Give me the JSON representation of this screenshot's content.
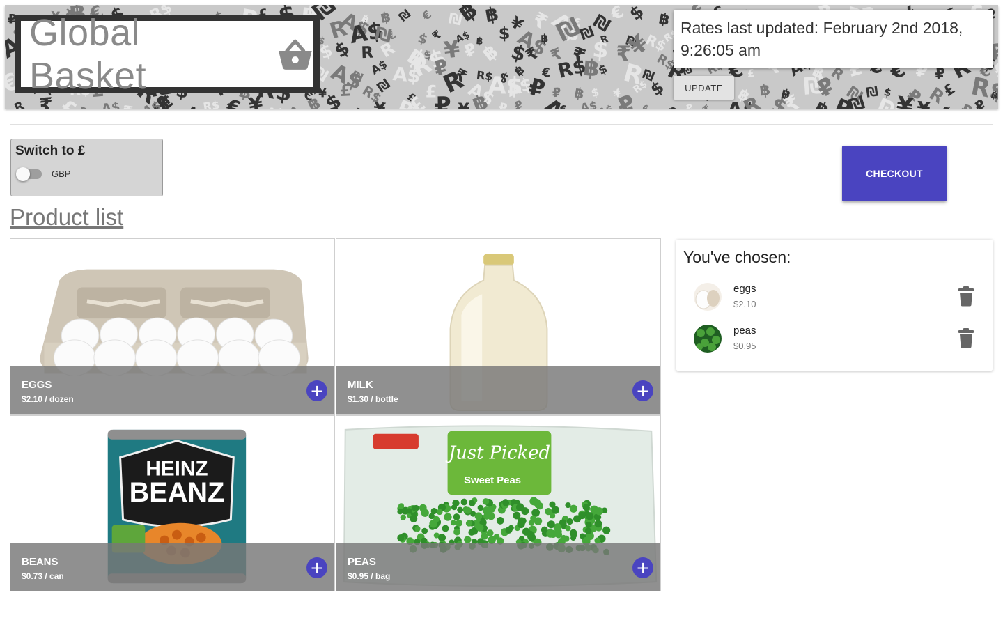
{
  "header": {
    "app_title": "Global Basket",
    "logo_icon": "basket-icon",
    "rates_text": "Rates last updated: February 2nd 2018, 9:26:05 am",
    "update_label": "UPDATE",
    "pattern_glyphs": [
      "฿",
      "₽",
      "$",
      "£",
      "€",
      "¥",
      "R$",
      "A$",
      "₪",
      "₹",
      "R"
    ]
  },
  "currency_switch": {
    "title": "Switch to £",
    "toggle_label": "GBP",
    "checked": false
  },
  "checkout_label": "CHECKOUT",
  "product_list_heading": "Product list",
  "products": [
    {
      "name": "EGGS",
      "price": "$2.10 / dozen",
      "image": "eggs-carton"
    },
    {
      "name": "MILK",
      "price": "$1.30 / bottle",
      "image": "milk-bottle"
    },
    {
      "name": "BEANS",
      "price": "$0.73 / can",
      "image": "heinz-beanz-can"
    },
    {
      "name": "PEAS",
      "price": "$0.95 / bag",
      "image": "frozen-peas-bag"
    }
  ],
  "product_image_text": {
    "beans_brand": "HEINZ",
    "beans_product": "BEANZ",
    "peas_brand": "Just Picked",
    "peas_product": "Sweet Peas"
  },
  "chosen": {
    "title": "You've chosen:",
    "items": [
      {
        "name": "eggs",
        "price": "$2.10"
      },
      {
        "name": "peas",
        "price": "$0.95"
      }
    ]
  },
  "colors": {
    "accent": "#4a44c0",
    "banner_bg": "#c9c9c9",
    "tile_bar": "#787878"
  }
}
